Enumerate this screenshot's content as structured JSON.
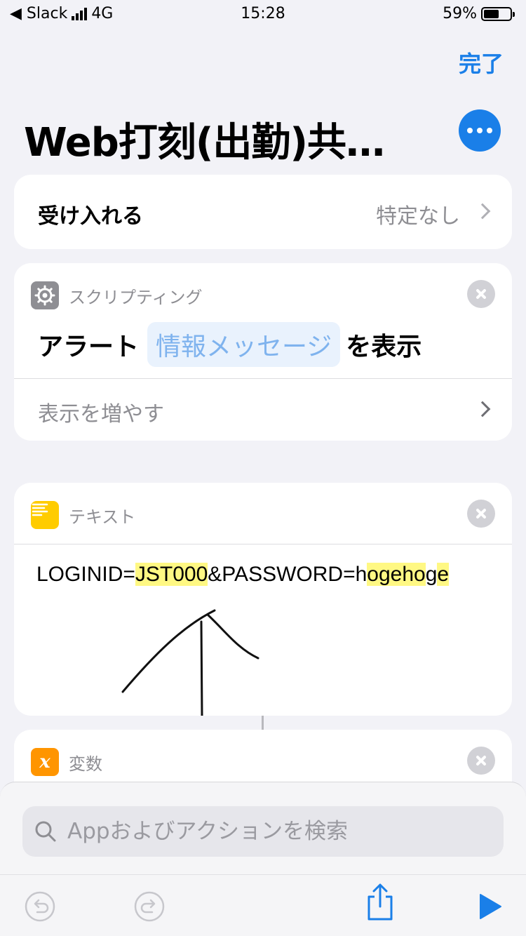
{
  "status_bar": {
    "back_app": "◀ Slack",
    "network": "4G",
    "time": "15:28",
    "battery_text": "59%",
    "battery_level": 0.59
  },
  "header": {
    "done_label": "完了",
    "title": "Web打刻(出勤)共…"
  },
  "accept": {
    "label": "受け入れる",
    "value": "特定なし"
  },
  "actions": [
    {
      "category": "スクリプティング",
      "text_before": "アラート",
      "token": "情報メッセージ",
      "text_after": "を表示",
      "more_label": "表示を増やす"
    },
    {
      "category": "テキスト",
      "text_parts": [
        "LOGINID=",
        "JST000",
        "&PASSWORD=h",
        "ogeho",
        "g",
        "e"
      ]
    },
    {
      "category": "変数"
    }
  ],
  "search": {
    "placeholder": "Appおよびアクションを検索"
  },
  "colors": {
    "accent": "#1a7fe8",
    "scripting_icon": "#8e8e93",
    "text_icon": "#ffcc00",
    "variable_icon": "#ff9500",
    "highlight": "#fff65a"
  },
  "icons": {
    "scripting": "gear-icon",
    "text": "text-lines-icon",
    "variable": "variable-x-icon",
    "search": "search-icon",
    "undo": "undo-icon",
    "redo": "redo-icon",
    "share": "share-icon",
    "play": "play-icon"
  }
}
